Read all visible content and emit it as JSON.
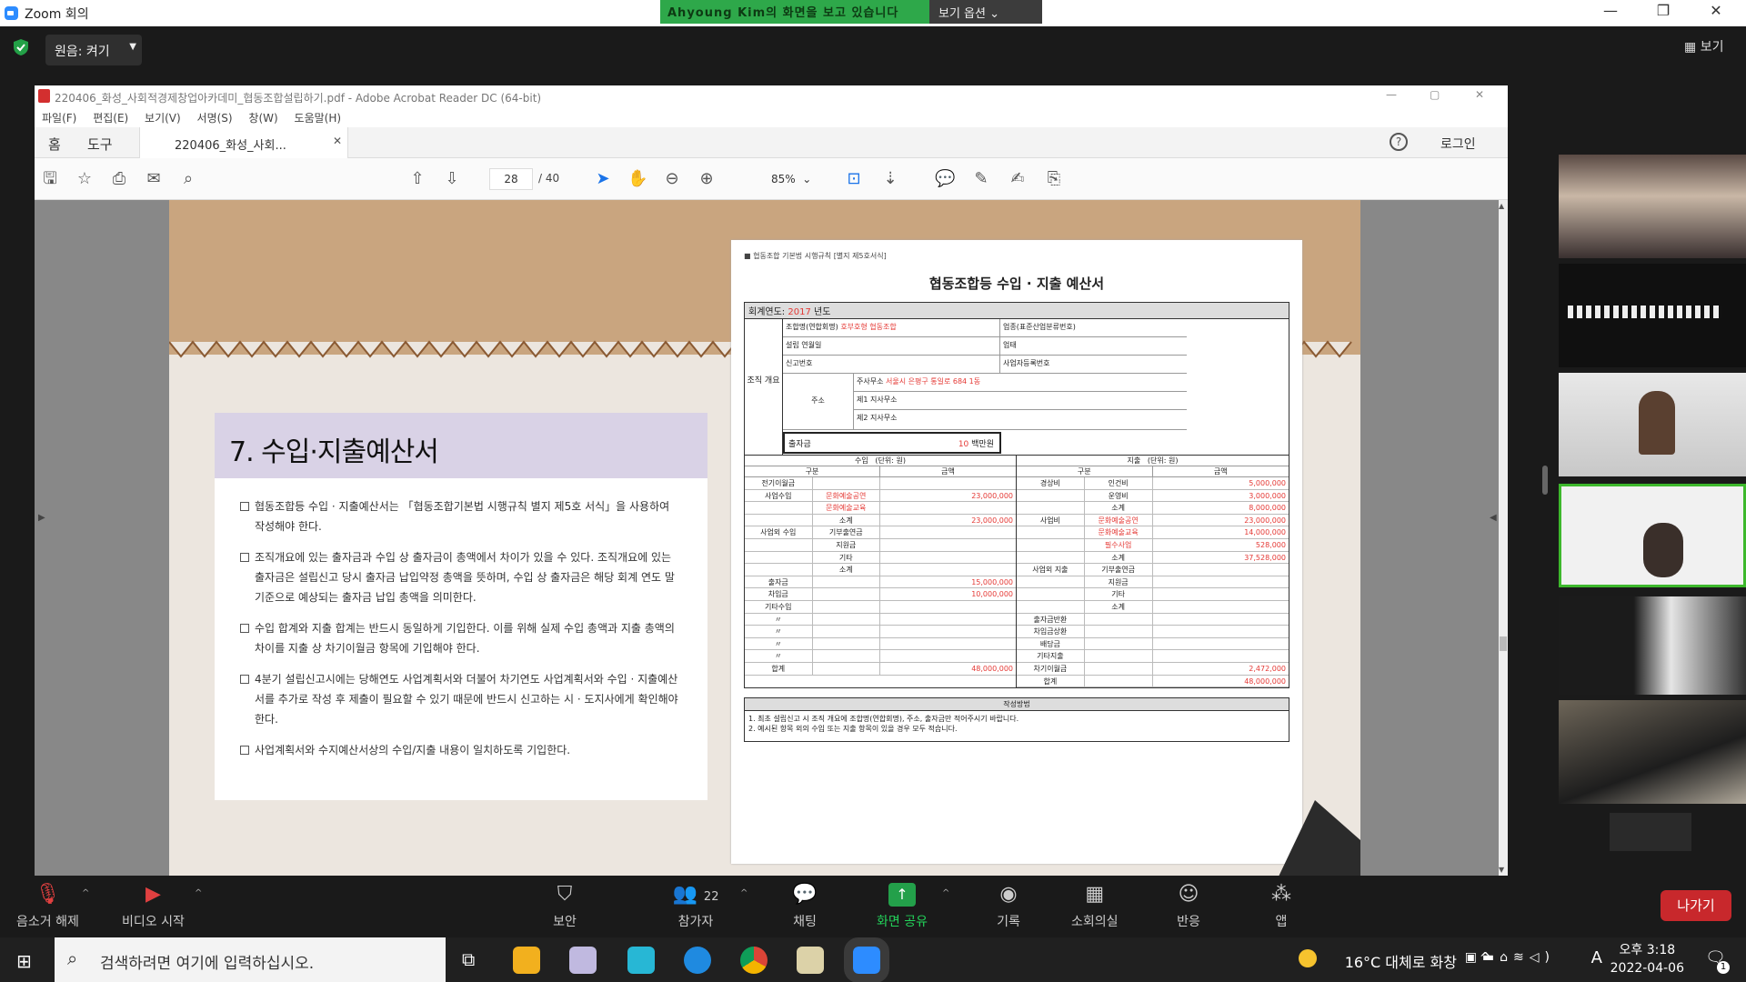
{
  "zoom": {
    "title": "Zoom 회의",
    "share_banner": "Ahyoung Kim의 화면을 보고 있습니다",
    "view_options": "보기 옵션",
    "original_sound": "원음: 켜기",
    "view_label": "보기",
    "controls": {
      "unmute": "음소거 해제",
      "start_video": "비디오 시작",
      "security": "보안",
      "participants": "참가자",
      "participants_count": "22",
      "chat": "채팅",
      "share_screen": "화면 공유",
      "record": "기록",
      "breakout": "소회의실",
      "reactions": "반응",
      "apps": "앱",
      "leave": "나가기"
    }
  },
  "acrobat": {
    "title": "220406_화성_사회적경제창업아카데미_협동조합설립하기.pdf - Adobe Acrobat Reader DC (64-bit)",
    "menu": [
      "파일(F)",
      "편집(E)",
      "보기(V)",
      "서명(S)",
      "창(W)",
      "도움말(H)"
    ],
    "tabs": {
      "home": "홈",
      "tools": "도구",
      "doc": "220406_화성_사회..."
    },
    "login": "로그인",
    "page_current": "28",
    "page_total": "/ 40",
    "zoom": "85%"
  },
  "slide": {
    "heading": "7. 수입·지출예산서",
    "bullets": [
      "협동조합등 수입 · 지출예산서는 「협동조합기본법 시행규칙 별지 제5호 서식」을 사용하여 작성해야 한다.",
      "조직개요에 있는 출자금과 수입 상 출자금이 총액에서 차이가 있을 수 있다. 조직개요에 있는 출자금은 설립신고 당시 출자금 납입약정 총액을 뜻하며, 수입 상 출자금은 해당 회계 연도 말 기준으로 예상되는 출자금 납입 총액을 의미한다.",
      "수입 합계와 지출 합계는 반드시 동일하게 기입한다. 이를 위해 실제 수입 총액과 지출 총액의 차이를 지출 상 차기이월금 항목에 기입해야 한다.",
      "4분기 설립신고시에는 당해연도 사업계획서와 더불어 차기연도 사업계획서와 수입 · 지출예산서를 추가로 작성 후 제출이 필요할 수 있기 때문에 반드시 신고하는 시 · 도지사에게 확인해야 한다.",
      "사업계획서와 수지예산서상의 수입/지출 내용이 일치하도록 기입한다."
    ]
  },
  "form": {
    "ref": "■ 협동조합 기본법 시행규칙 [별지 제5호서식]",
    "title": "협동조합등 수입 · 지출 예산서",
    "year_label": "회계연도:",
    "year": "2017",
    "year_suffix": "년도",
    "org_label": "조직 개요",
    "org_name_label": "조합명(연합회명)",
    "org_name": "호부호형 협동조합",
    "industry_code": "업종(표준산업분류번호)",
    "founded": "설립 연월일",
    "business": "업태",
    "report_no": "신고번호",
    "biz_reg_no": "사업자등록번호",
    "addr_label": "주소",
    "hq_label": "주사무소",
    "hq": "서울시 은평구 통일로 684 1동",
    "branch1": "제1 지사무소",
    "branch2": "제2 지사무소",
    "capital_label": "출자금",
    "capital_value": "10",
    "capital_unit": "백만원",
    "income_header": "수입",
    "expense_header": "지출",
    "unit": "(단위: 원)",
    "col_type": "구분",
    "col_amount": "금액",
    "income": [
      {
        "group": "전기이월금",
        "item": "",
        "amount": ""
      },
      {
        "group": "사업수입",
        "item": "문화예술공연",
        "amount": "23,000,000",
        "red": true
      },
      {
        "group": "",
        "item": "문화예술교육",
        "amount": "",
        "red": true
      },
      {
        "group": "",
        "item": "소계",
        "amount": "23,000,000"
      },
      {
        "group": "사업외 수입",
        "item": "기부출연금",
        "amount": ""
      },
      {
        "group": "",
        "item": "지원금",
        "amount": ""
      },
      {
        "group": "",
        "item": "기타",
        "amount": ""
      },
      {
        "group": "",
        "item": "소계",
        "amount": ""
      },
      {
        "group": "출자금",
        "item": "",
        "amount": "15,000,000"
      },
      {
        "group": "차입금",
        "item": "",
        "amount": "10,000,000"
      },
      {
        "group": "기타수입",
        "item": "",
        "amount": ""
      },
      {
        "group": "〃",
        "item": "",
        "amount": ""
      },
      {
        "group": "〃",
        "item": "",
        "amount": ""
      },
      {
        "group": "〃",
        "item": "",
        "amount": ""
      },
      {
        "group": "〃",
        "item": "",
        "amount": ""
      },
      {
        "group": "합계",
        "item": "",
        "amount": "48,000,000"
      }
    ],
    "expense": [
      {
        "group": "경상비",
        "item": "인건비",
        "amount": "5,000,000"
      },
      {
        "group": "",
        "item": "운영비",
        "amount": "3,000,000"
      },
      {
        "group": "",
        "item": "소계",
        "amount": "8,000,000"
      },
      {
        "group": "사업비",
        "item": "문화예술공연",
        "amount": "23,000,000",
        "red": true
      },
      {
        "group": "",
        "item": "문화예술교육",
        "amount": "14,000,000",
        "red": true
      },
      {
        "group": "",
        "item": "필수사업",
        "amount": "528,000",
        "red": true
      },
      {
        "group": "",
        "item": "소계",
        "amount": "37,528,000"
      },
      {
        "group": "사업외 지출",
        "item": "기부출연금",
        "amount": ""
      },
      {
        "group": "",
        "item": "지원금",
        "amount": ""
      },
      {
        "group": "",
        "item": "기타",
        "amount": ""
      },
      {
        "group": "",
        "item": "소계",
        "amount": ""
      },
      {
        "group": "출자금반환",
        "item": "",
        "amount": ""
      },
      {
        "group": "차입금상환",
        "item": "",
        "amount": ""
      },
      {
        "group": "배당금",
        "item": "",
        "amount": ""
      },
      {
        "group": "기타지출",
        "item": "",
        "amount": ""
      },
      {
        "group": "차기이월금",
        "item": "",
        "amount": "2,472,000"
      },
      {
        "group": "합계",
        "item": "",
        "amount": "48,000,000"
      }
    ],
    "method_title": "작성방법",
    "method_1": "1. 최초 설립신고 시 조직 개요에 조합명(연합회명), 주소, 출자금만 적어주시기 바랍니다.",
    "method_2": "2. 예시된 항목 외의 수입 또는 지출 항목이 있을 경우 모두 적습니다."
  },
  "taskbar": {
    "search_placeholder": "검색하려면 여기에 입력하십시오.",
    "weather": "16°C 대체로 화창",
    "ime": "A",
    "time": "오후 3:18",
    "date": "2022-04-06",
    "notif_count": "1"
  },
  "colors": {
    "zoom_bg": "#1a1a1a",
    "share_green": "#2ea84a",
    "leave_red": "#c8282c",
    "form_red": "#e53935",
    "accent_blue": "#2d8cff"
  }
}
